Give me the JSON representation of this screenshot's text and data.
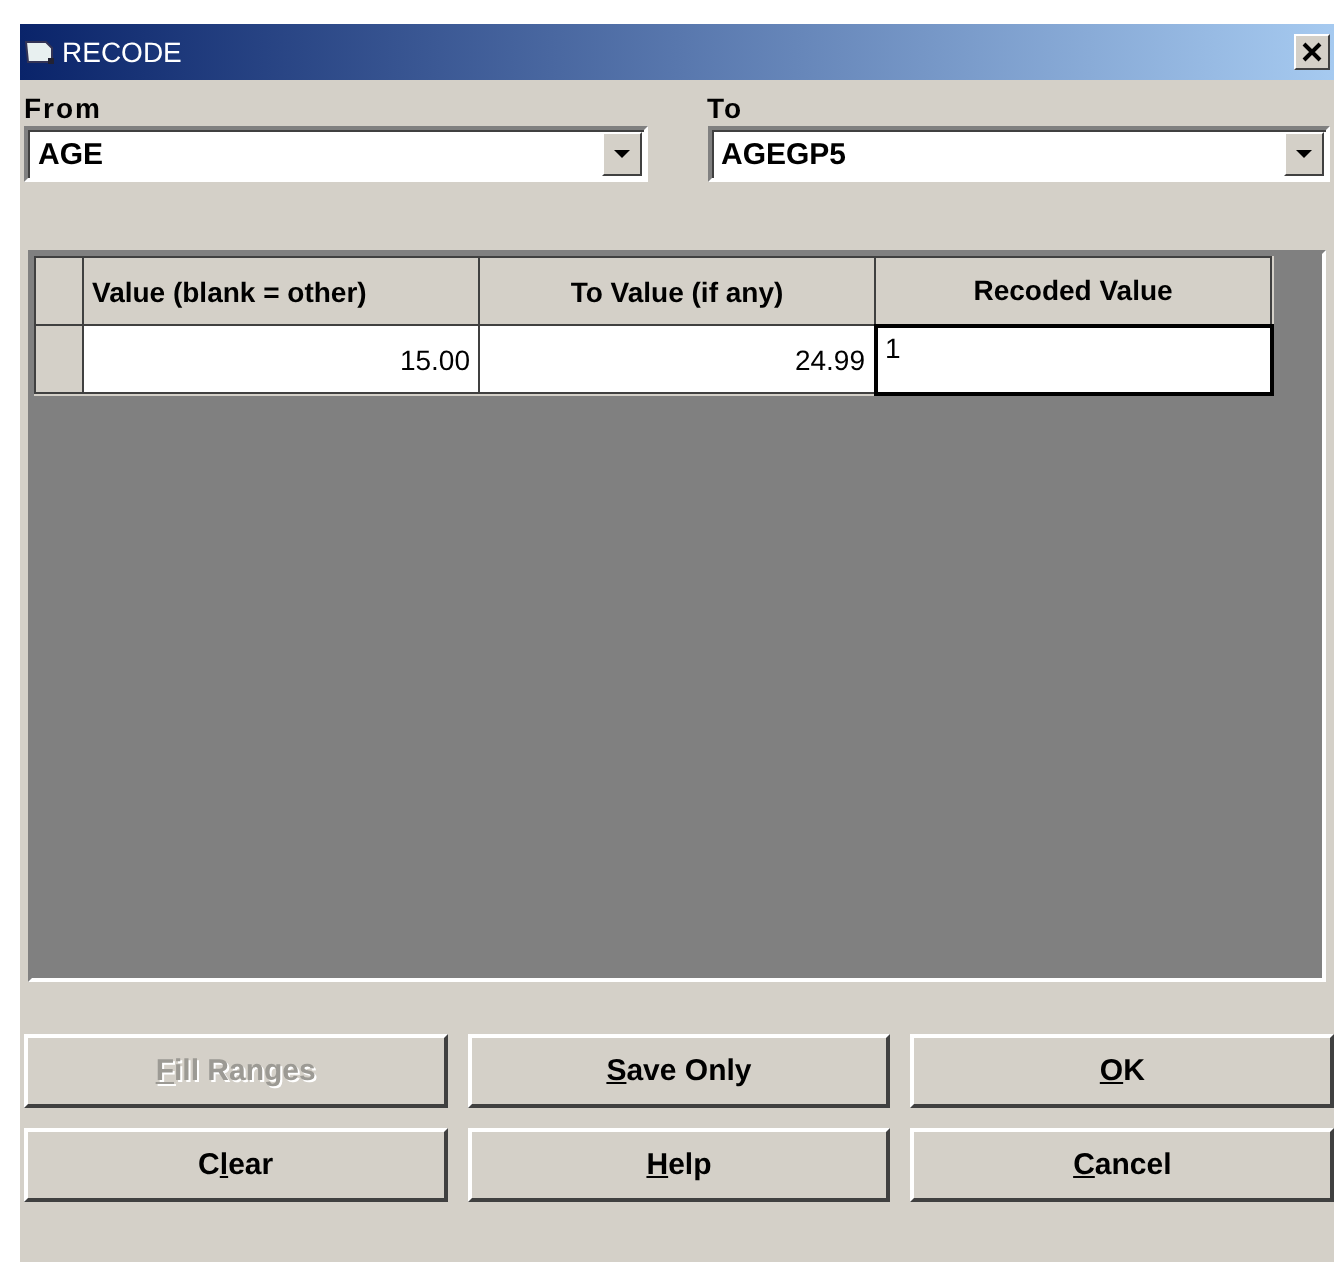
{
  "window": {
    "title": "RECODE"
  },
  "from": {
    "label": "From",
    "value": "AGE"
  },
  "to": {
    "label": "To",
    "value": "AGEGP5"
  },
  "table": {
    "columns": [
      "Value (blank = other)",
      "To Value (if any)",
      "Recoded Value"
    ],
    "rows": [
      {
        "cells": [
          {
            "value": "15.00",
            "selected": false
          },
          {
            "value": "24.99",
            "selected": false
          },
          {
            "value": "1",
            "selected": true
          }
        ]
      }
    ]
  },
  "buttons": [
    {
      "hotkey": "F",
      "rest": "ill Ranges",
      "disabled": true
    },
    {
      "hotkey": "S",
      "rest": "ave Only",
      "disabled": false
    },
    {
      "hotkey": "O",
      "rest": "K",
      "disabled": false
    },
    {
      "lead": "C",
      "hotkey": "l",
      "rest": "ear",
      "disabled": false
    },
    {
      "hotkey": "H",
      "rest": "elp",
      "disabled": false
    },
    {
      "hotkey": "C",
      "rest": "ancel",
      "disabled": false
    }
  ]
}
